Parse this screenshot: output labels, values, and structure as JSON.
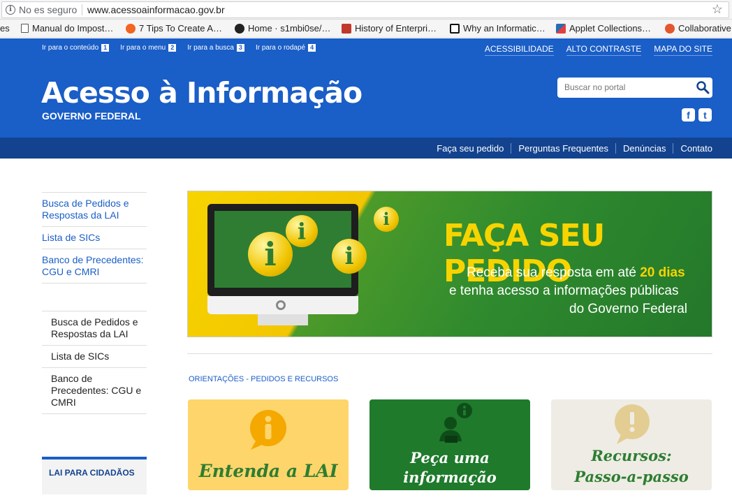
{
  "browser": {
    "security_text": "No es seguro",
    "url": "www.acessoainformacao.gov.br",
    "bookmarks": [
      {
        "label": "es",
        "icon": "none"
      },
      {
        "label": "Manual do Impost…",
        "icon": "page-icon"
      },
      {
        "label": "7 Tips To Create A…",
        "icon": "orange-face-icon"
      },
      {
        "label": "Home · s1mbi0se/…",
        "icon": "github-icon"
      },
      {
        "label": "History of Enterpri…",
        "icon": "hpi-icon"
      },
      {
        "label": "Why an Informatic…",
        "icon": "c-icon"
      },
      {
        "label": "Applet Collections…",
        "icon": "applet-icon"
      },
      {
        "label": "Collaborative",
        "icon": "k-icon"
      }
    ]
  },
  "header": {
    "skip_links": [
      {
        "label": "Ir para o conteúdo",
        "key": "1"
      },
      {
        "label": "Ir para o menu",
        "key": "2"
      },
      {
        "label": "Ir para a busca",
        "key": "3"
      },
      {
        "label": "Ir para o rodapé",
        "key": "4"
      }
    ],
    "top_links": [
      "ACESSIBILIDADE",
      "ALTO CONTRASTE",
      "MAPA DO SITE"
    ],
    "title": "Acesso à Informação",
    "subtitle": "GOVERNO FEDERAL",
    "search_placeholder": "Buscar no portal",
    "social": [
      "f",
      "t"
    ],
    "brand_color": "#1a5ec7",
    "nav_color": "#13438f"
  },
  "nav": [
    "Faça seu pedido",
    "Perguntas Frequentes",
    "Denúncias",
    "Contato"
  ],
  "sidebar": {
    "primary": [
      "Busca de Pedidos e Respostas da LAI",
      "Lista de SICs",
      "Banco de Precedentes: CGU e CMRI"
    ],
    "secondary": [
      "Busca de Pedidos e Respostas da LAI",
      "Lista de SICs",
      "Banco de Precedentes: CGU e CMRI"
    ],
    "box_title": "LAI PARA CIDADÃOS"
  },
  "banner": {
    "title": "FAÇA SEU PEDIDO",
    "line1_prefix": "Receba sua resposta em até ",
    "line1_highlight": "20 dias",
    "line2": "e tenha acesso a informações públicas",
    "line3": "do Governo Federal",
    "bubble_glyph": "i"
  },
  "section": {
    "title": "ORIENTAÇÕES - PEDIDOS E RECURSOS",
    "cards": [
      {
        "label": "Entenda a LAI",
        "icon": "info-icon",
        "glyph": "i"
      },
      {
        "label_line1": "Peça uma",
        "label_line2": "informação",
        "icon": "person-info-icon",
        "glyph": "i"
      },
      {
        "label_line1": "Recursos:",
        "label_line2": "Passo-a-passo",
        "icon": "alert-icon",
        "glyph": "!"
      }
    ]
  }
}
